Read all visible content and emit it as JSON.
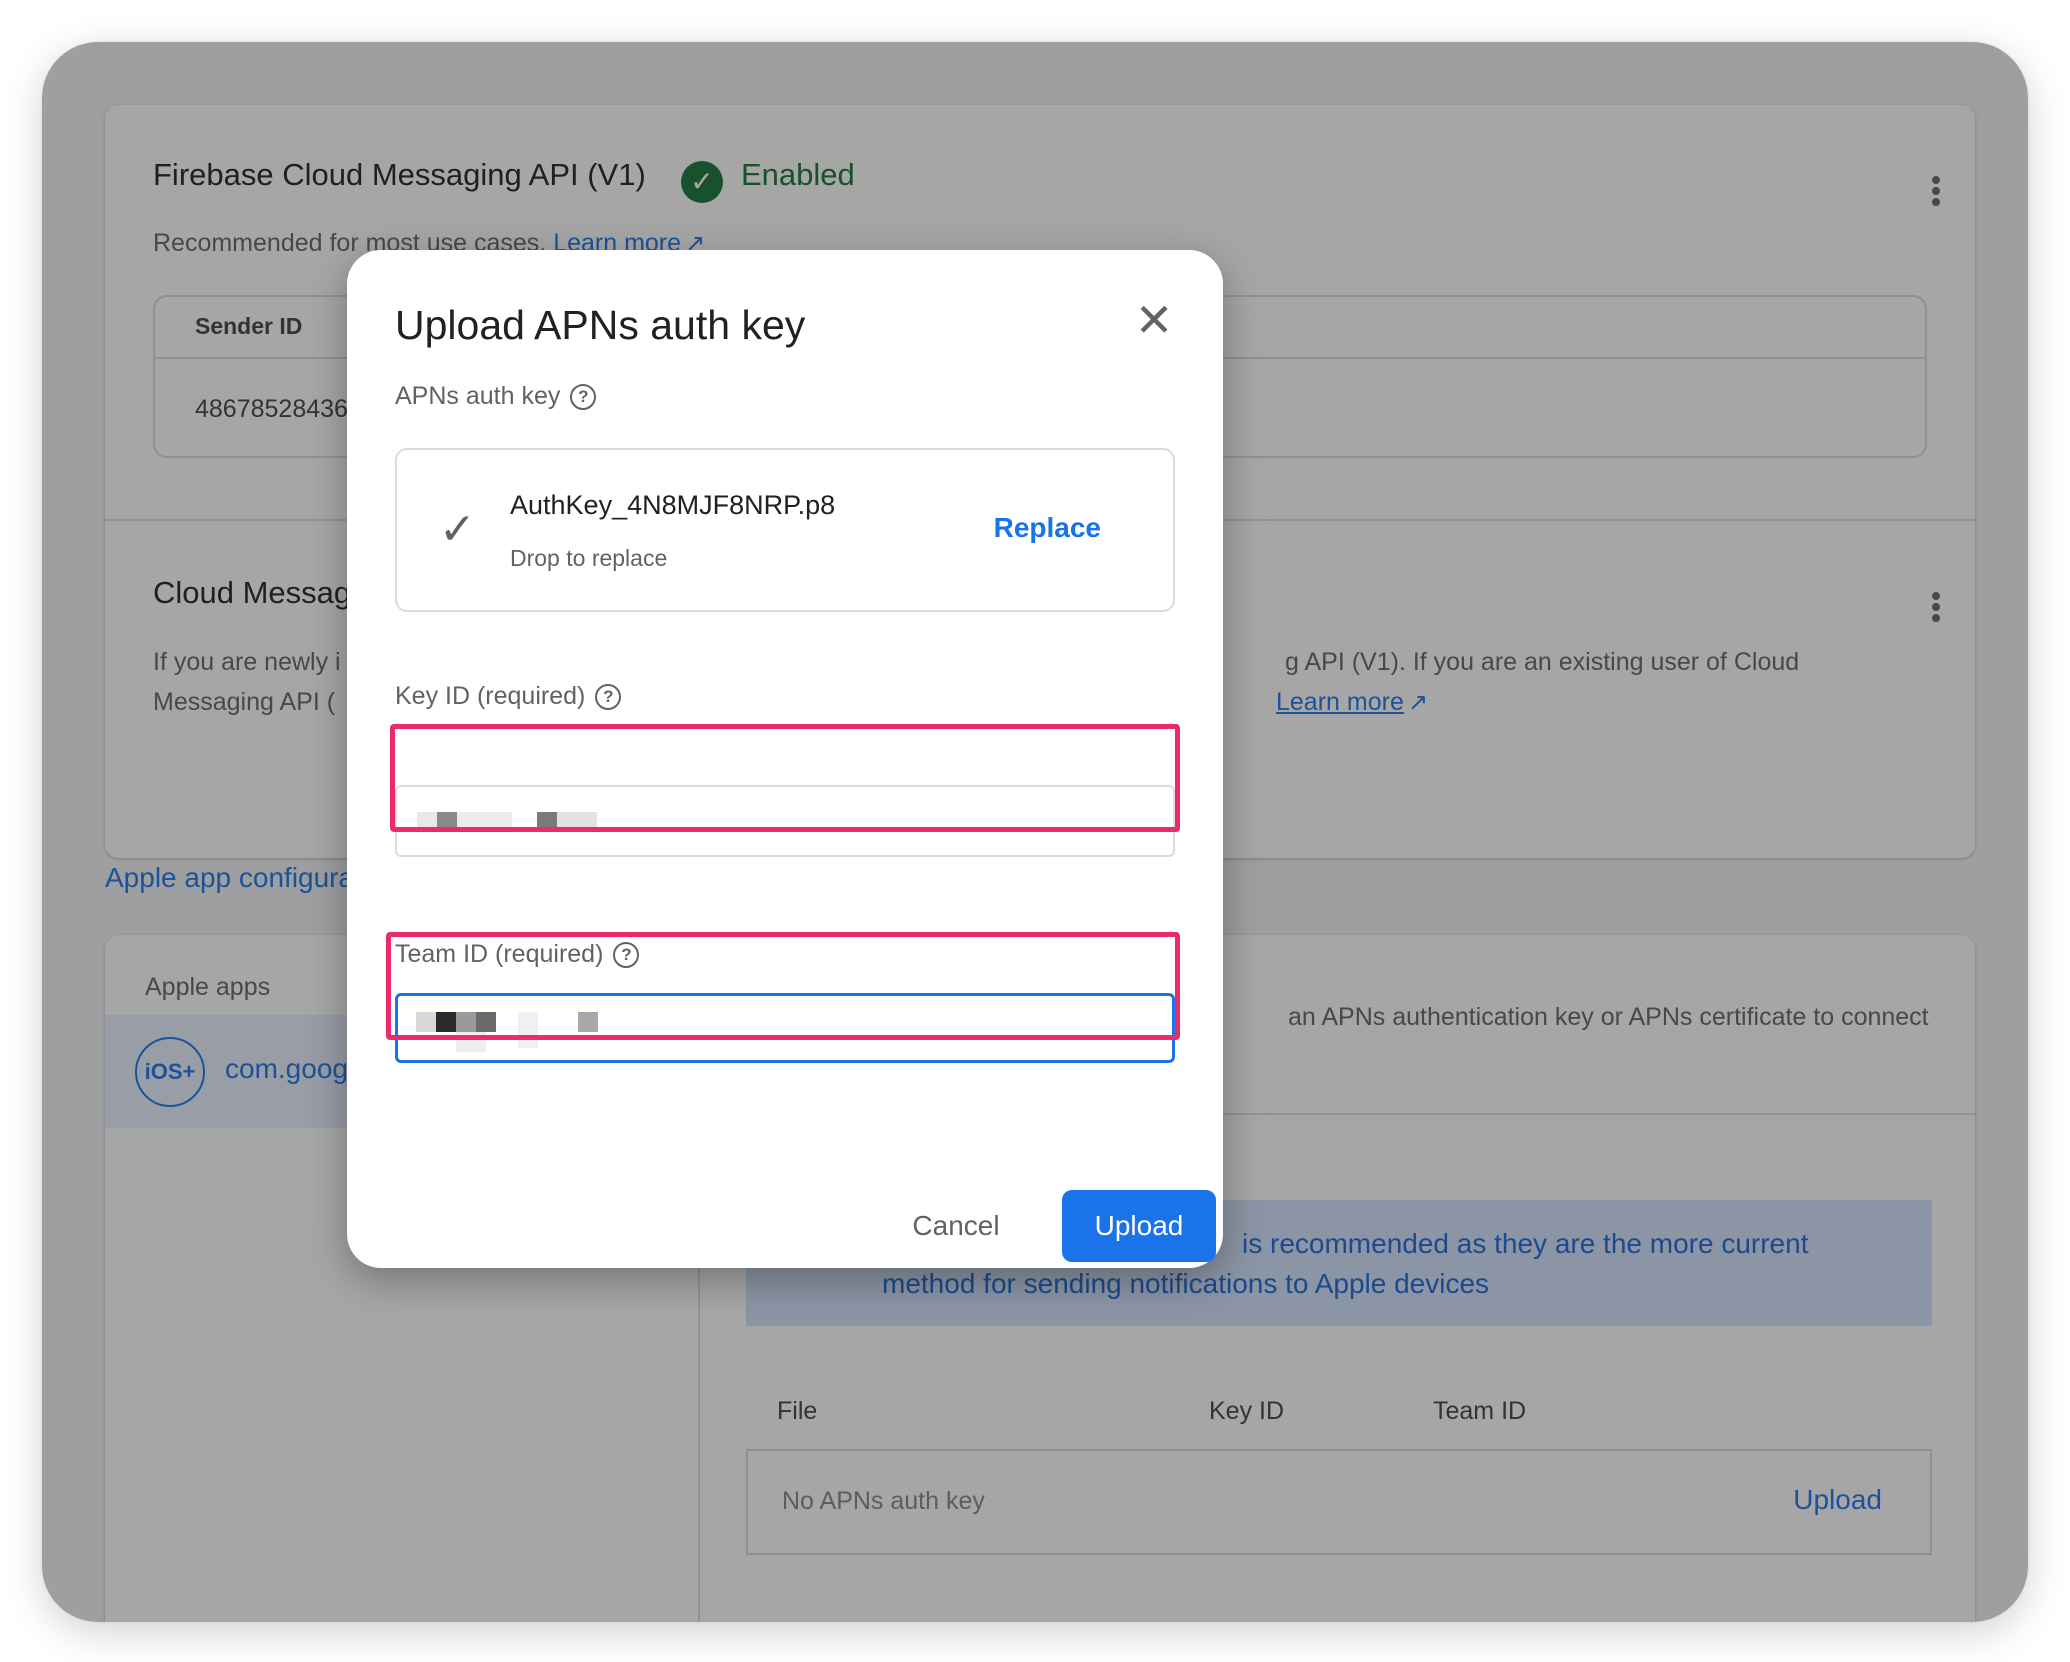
{
  "background": {
    "fcm_v1": {
      "title": "Firebase Cloud Messaging API (V1)",
      "status": "Enabled",
      "description": "Recommended for most use cases.",
      "learn_more": "Learn more",
      "table_header": "Sender ID",
      "table_value": "48678528436"
    },
    "legacy": {
      "title": "Cloud Messag",
      "line1_left": "If you are newly i",
      "line1_right": "g API (V1). If you are an existing user of Cloud",
      "line2_left": "Messaging API (",
      "learn_more": "Learn more"
    },
    "apple_section_label": "Apple app configura",
    "apple_apps_label": "Apple apps",
    "app": {
      "badge": "iOS+",
      "name": "com.goog"
    },
    "auth_desc": "an APNs authentication key or APNs certificate to connect",
    "banner": {
      "line1": "is recommended as they are the more current",
      "line2": "method for sending notifications to Apple devices"
    },
    "columns": [
      "File",
      "Key ID",
      "Team ID"
    ],
    "empty_row": "No APNs auth key",
    "empty_upload": "Upload"
  },
  "dialog": {
    "title": "Upload APNs auth key",
    "auth_key_label": "APNs auth key",
    "file_name": "AuthKey_4N8MJF8NRP.p8",
    "drop_hint": "Drop to replace",
    "replace": "Replace",
    "key_id_label": "Key ID (required)",
    "team_id_label": "Team ID (required)",
    "cancel": "Cancel",
    "upload": "Upload"
  },
  "colors": {
    "accent": "#1a73e8",
    "enabled": "#137333",
    "highlight": "#ea2c6d"
  },
  "icons": {
    "enabled": "check-circle-icon",
    "external": "external-link-icon",
    "menu": "more-vert-icon",
    "close": "close-icon",
    "help": "help-circle-icon",
    "file_ok": "check-icon"
  }
}
